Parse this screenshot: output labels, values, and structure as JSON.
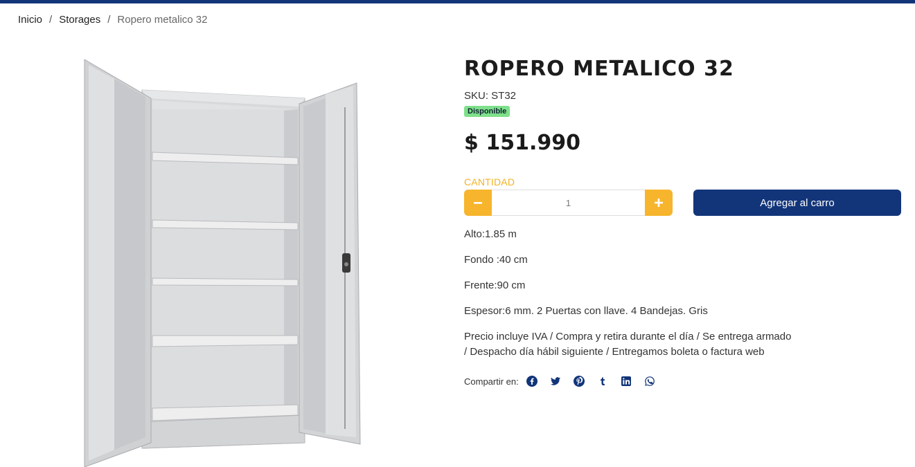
{
  "breadcrumb": {
    "items": [
      "Inicio",
      "Storages"
    ],
    "separator": "/",
    "current": "Ropero metalico 32"
  },
  "product": {
    "title": "ROPERO METALICO 32",
    "sku": "SKU: ST32",
    "availability": "Disponible",
    "price": "$ 151.990",
    "quantity_label": "CANTIDAD",
    "quantity": "1",
    "add_to_cart": "Agregar al carro",
    "specs": [
      "Alto:1.85 m",
      "Fondo :40 cm",
      "Frente:90 cm",
      "Espesor:6 mm.  2 Puertas con llave. 4 Bandejas. Gris",
      "Precio incluye IVA  / Compra y retira durante el día / Se entrega armado / Despacho día hábil siguiente / Entregamos boleta o factura web"
    ]
  },
  "share": {
    "label": "Compartir en:",
    "icons": [
      "facebook-icon",
      "twitter-icon",
      "pinterest-icon",
      "tumblr-icon",
      "linkedin-icon",
      "whatsapp-icon"
    ]
  },
  "colors": {
    "brand_blue": "#12357a",
    "accent_yellow": "#f7b52d",
    "badge_green": "#7ee08a"
  }
}
